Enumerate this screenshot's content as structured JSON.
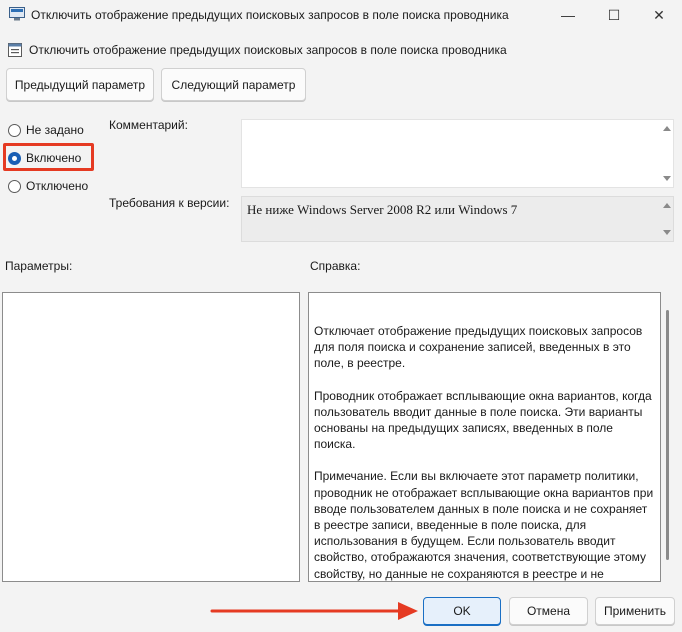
{
  "window": {
    "title": "Отключить отображение предыдущих поисковых запросов в поле поиска проводника",
    "controls": {
      "minimize": "—",
      "maximize": "☐",
      "close": "✕"
    }
  },
  "header": {
    "policy_name": "Отключить отображение предыдущих поисковых запросов в поле поиска проводника"
  },
  "nav_buttons": {
    "previous": "Предыдущий параметр",
    "next": "Следующий параметр"
  },
  "state_options": {
    "not_configured": "Не задано",
    "enabled": "Включено",
    "disabled": "Отключено",
    "selected": "enabled"
  },
  "comment": {
    "label": "Комментарий:",
    "value": ""
  },
  "supported_on": {
    "label": "Требования к версии:",
    "value": "Не ниже Windows Server 2008 R2 или Windows 7"
  },
  "sections": {
    "options_label": "Параметры:",
    "help_label": "Справка:"
  },
  "help": {
    "paragraphs": [
      "Отключает отображение предыдущих поисковых запросов для поля поиска и сохранение записей, введенных в это поле, в реестре.",
      "Проводник отображает всплывающие окна вариантов, когда пользователь вводит данные в поле поиска.  Эти варианты основаны на предыдущих записях, введенных в поле поиска.",
      "Примечание. Если вы включаете этот параметр политики, проводник не отображает всплывающие окна вариантов при вводе пользователем данных в поле поиска и не сохраняет в реестре записи, введенные в поле поиска, для использования в будущем.  Если пользователь вводит свойство, отображаются значения, соответствующие этому свойству, но данные не сохраняются в реестре и не отображаются впоследствии при использовании поля поиска."
    ]
  },
  "footer_buttons": {
    "ok": "OK",
    "cancel": "Отмена",
    "apply": "Применить"
  },
  "colors": {
    "highlight": "#e53a22",
    "accent": "#1a5fb4"
  }
}
